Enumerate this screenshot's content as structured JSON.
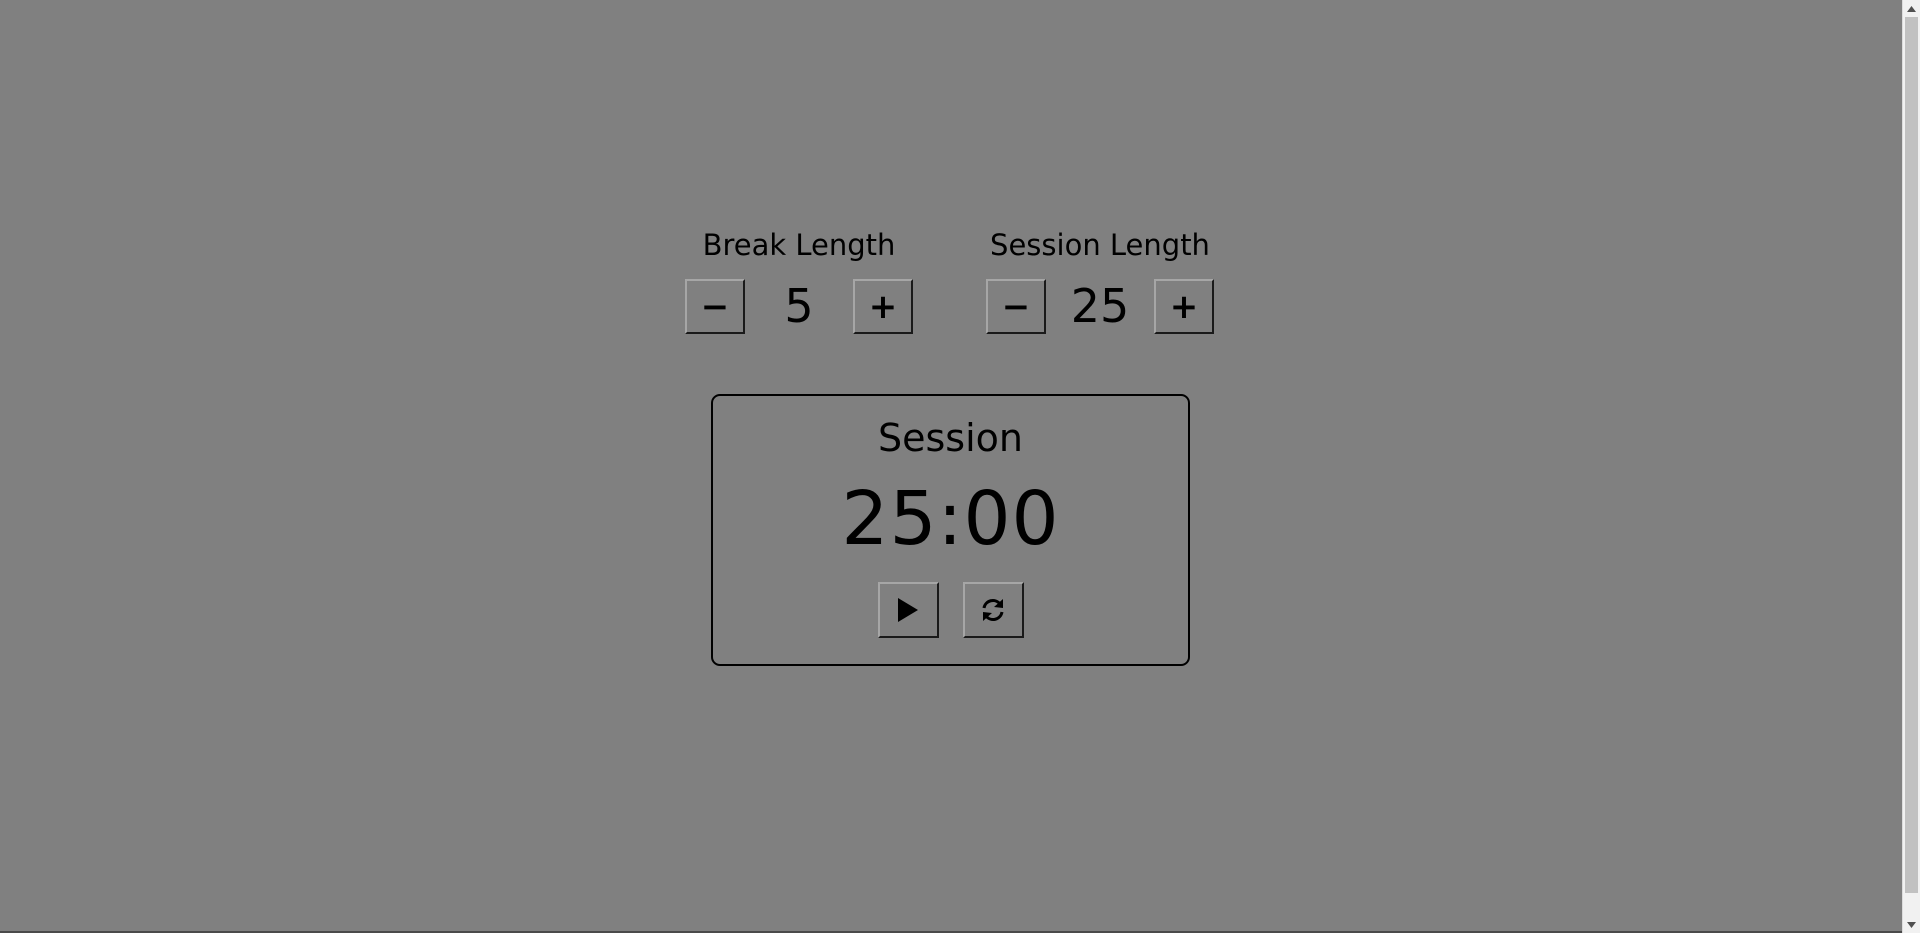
{
  "break_control": {
    "label": "Break Length",
    "value": "5",
    "decrement_symbol": "−",
    "increment_symbol": "+"
  },
  "session_control": {
    "label": "Session Length",
    "value": "25",
    "decrement_symbol": "−",
    "increment_symbol": "+"
  },
  "timer": {
    "label": "Session",
    "time": "25:00",
    "play_icon": "play-icon",
    "reset_icon": "refresh-icon"
  },
  "colors": {
    "background": "#808080",
    "text": "#000000",
    "scrollbar_thumb": "#c1c1c1"
  }
}
